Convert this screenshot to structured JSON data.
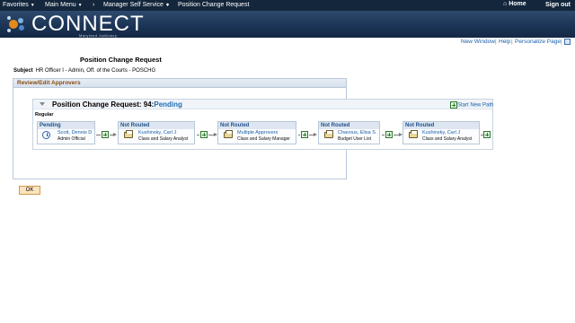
{
  "topnav": {
    "favorites": "Favorites",
    "main_menu": "Main Menu",
    "separator": "›",
    "manager_self_service": "Manager Self Service",
    "current_page": "Position Change Request",
    "home": "Home",
    "sign_out": "Sign out"
  },
  "banner": {
    "logo_text": "CONNECT",
    "logo_subtext": "Maryland Judiciary"
  },
  "utility_links": {
    "new_window": "New Window",
    "help": "Help",
    "personalize_page": "Personalize Page",
    "separator": "|"
  },
  "page": {
    "title": "Position Change Request",
    "subject_label": "Subject",
    "subject_value": "HR Officer I - Admin, Off. of the Courts - POSCHG"
  },
  "panel": {
    "title": "Review/Edit Approvers"
  },
  "chain": {
    "title_prefix": "Position Change Request: 94:",
    "status": "Pending",
    "start_new_path": "Start New Path",
    "path_label": "Regular",
    "steps": [
      {
        "status": "Pending",
        "name": "Scott, Dennis D",
        "role": "Admin Official",
        "icon": "clock-icon"
      },
      {
        "status": "Not Routed",
        "name": "Kushinsky, Carl J",
        "role": "Class and Salary Analyst",
        "icon": "in-tray-icon"
      },
      {
        "status": "Not Routed",
        "name": "Multiple Approvers",
        "role": "Class and Salary Manager",
        "icon": "in-tray-icon"
      },
      {
        "status": "Not Routed",
        "name": "Chavous, Elisa S",
        "role": "Budget User List",
        "icon": "in-tray-icon"
      },
      {
        "status": "Not Routed",
        "name": "Kushinsky, Carl J",
        "role": "Class and Salary Analyst",
        "icon": "in-tray-icon"
      }
    ]
  },
  "actions": {
    "ok_label": "OK"
  },
  "colors": {
    "nav_bg": "#13263b",
    "banner_bg": "#1c3556",
    "link": "#1a5fa8",
    "panel_title": "#8a4b0f",
    "button_bg": "#fbe3bd"
  }
}
